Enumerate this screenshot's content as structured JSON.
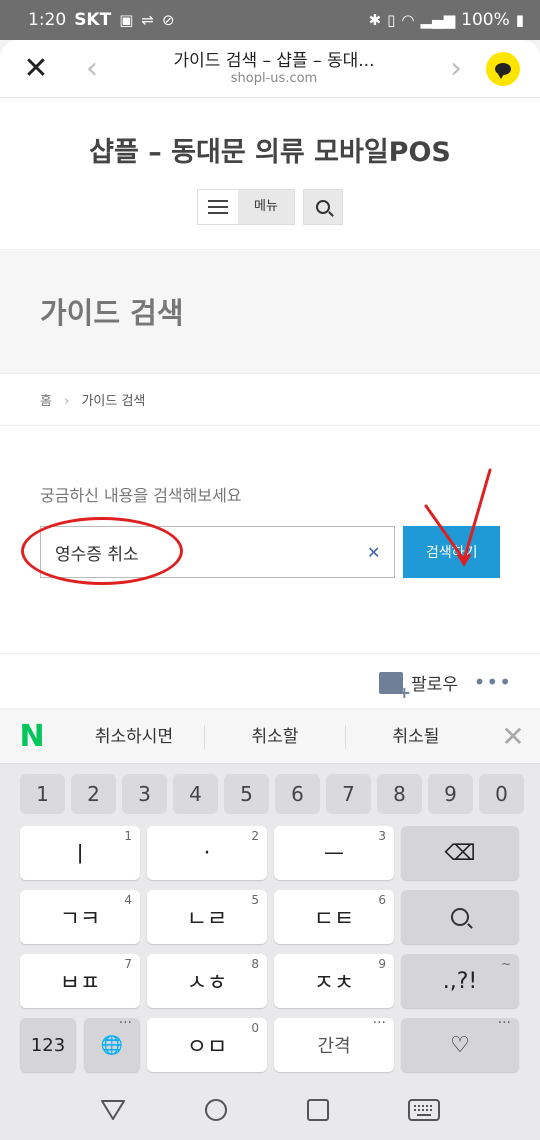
{
  "status_bar": {
    "time": "1:20",
    "carrier": "SKT",
    "battery": "100%"
  },
  "browser": {
    "title": "가이드 검색 – 샵플 – 동대...",
    "url": "shopl-us.com"
  },
  "site": {
    "title": "샵플 – 동대문 의류 모바일POS",
    "menu_label": "메뉴"
  },
  "hero": {
    "title": "가이드 검색"
  },
  "breadcrumb": {
    "home": "홈",
    "separator": "›",
    "current": "가이드 검색"
  },
  "search": {
    "label": "궁금하신 내용을 검색해보세요",
    "value": "영수증 취소",
    "clear": "✕",
    "button": "검색하기"
  },
  "toolbar": {
    "follow": "팔로우",
    "more": "•••"
  },
  "suggestions": {
    "logo": "N",
    "items": [
      "취소하시면",
      "취소할",
      "취소될"
    ],
    "close": "✕"
  },
  "keyboard": {
    "numbers": [
      "1",
      "2",
      "3",
      "4",
      "5",
      "6",
      "7",
      "8",
      "9",
      "0"
    ],
    "row1": [
      {
        "label": "ㅣ",
        "sub": "1"
      },
      {
        "label": "·",
        "sub": "2"
      },
      {
        "label": "ㅡ",
        "sub": "3"
      }
    ],
    "row2": [
      {
        "label": "ㄱㅋ",
        "sub": "4"
      },
      {
        "label": "ㄴㄹ",
        "sub": "5"
      },
      {
        "label": "ㄷㅌ",
        "sub": "6"
      }
    ],
    "row3": [
      {
        "label": "ㅂㅍ",
        "sub": "7"
      },
      {
        "label": "ㅅㅎ",
        "sub": "8"
      },
      {
        "label": "ㅈㅊ",
        "sub": "9"
      }
    ],
    "row4": [
      {
        "label": "ㅇㅁ",
        "sub": "0"
      }
    ],
    "punct": ".,?!",
    "mode": "123",
    "space": "간격",
    "heart": "♡",
    "backspace": "⌫",
    "more_dots": "···",
    "tilde": "~",
    "globe": "🌐"
  },
  "annotation_color": "#e02020",
  "accent_color": "#1f9ad6"
}
